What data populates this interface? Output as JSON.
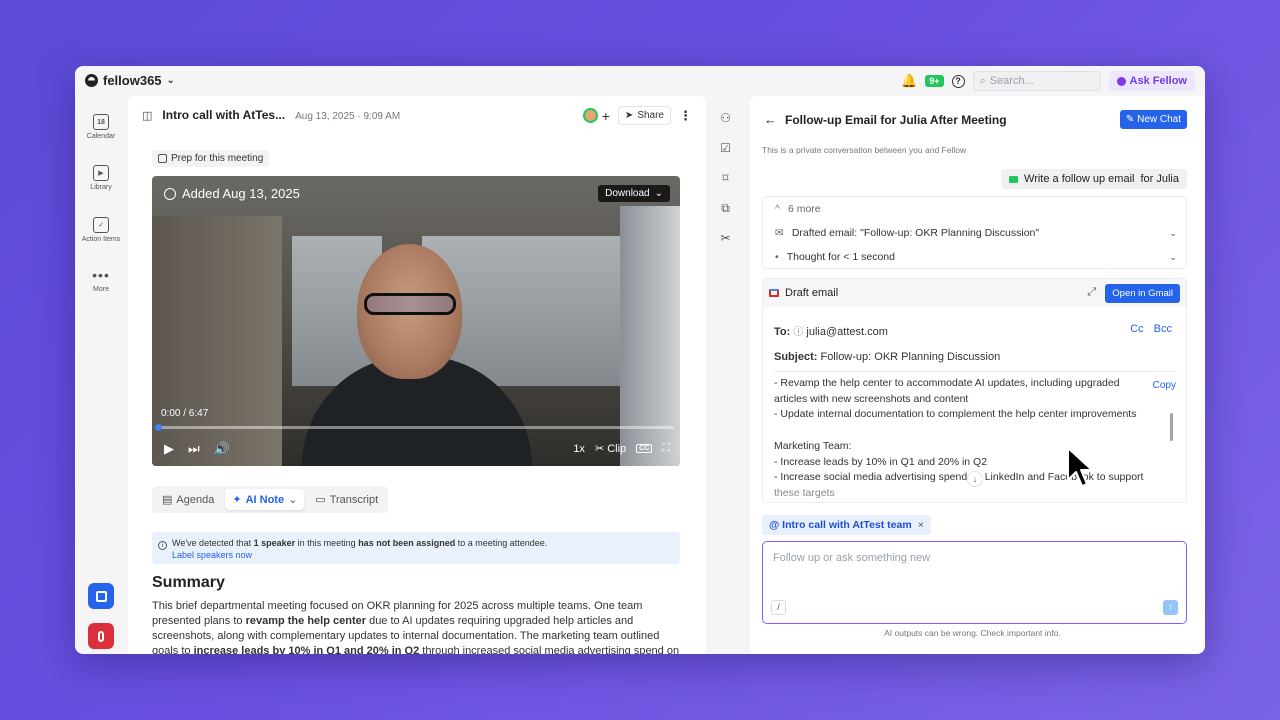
{
  "app": {
    "brand": "fellow365",
    "brand_caret": "⌄"
  },
  "topbar": {
    "notification_badge": "9+",
    "help_glyph": "?",
    "search_placeholder": "Search...",
    "ask_fellow_label": "Ask Fellow"
  },
  "rail": {
    "items": [
      {
        "label": "Calendar",
        "icon": "calendar-icon",
        "glyph": "18"
      },
      {
        "label": "Library",
        "icon": "library-icon",
        "glyph": "▶"
      },
      {
        "label": "Action Items",
        "icon": "checkbox-icon",
        "glyph": "✓"
      },
      {
        "label": "More",
        "icon": "more-icon",
        "glyph": "•••"
      }
    ],
    "bottom_buttons": [
      {
        "icon": "notes-icon",
        "color": "#2563eb"
      },
      {
        "icon": "microphone-icon",
        "color": "#dc2f3c"
      }
    ]
  },
  "meeting": {
    "title": "Intro call with AtTes...",
    "date": "Aug 13, 2025 · 9:09 AM",
    "share_label": "Share",
    "prep_label": "Prep for this meeting"
  },
  "video": {
    "added_label": "Added Aug 13, 2025",
    "download_label": "Download",
    "time": "0:00 / 6:47",
    "progress": 0,
    "speed": "1x",
    "clip_label": "Clip",
    "cc_label": "CC"
  },
  "tabs": [
    {
      "label": "Agenda",
      "active": false
    },
    {
      "label": "AI Note",
      "active": true
    },
    {
      "label": "Transcript",
      "active": false
    }
  ],
  "alert": {
    "text_1": "We've detected that ",
    "bold_1": "1 speaker",
    "text_2": " in this meeting ",
    "bold_2": "has not been assigned",
    "text_3": " to a meeting attendee.",
    "link": "Label speakers now"
  },
  "summary": {
    "title": "Summary",
    "p1": "This brief departmental meeting focused on OKR planning for 2025 across multiple teams. One team presented plans to ",
    "b1": "revamp the help center",
    "p2": " due to AI updates requiring upgraded help articles and screenshots, along with complementary updates to internal documentation. The marketing team outlined goals to ",
    "b2": "increase leads by 10% in Q1 and 20% in Q2",
    "p3": " through increased social media advertising spend on"
  },
  "chat": {
    "title": "Follow-up Email for Julia After Meeting",
    "new_chat_label": "New Chat",
    "private_note": "This is a private conversation between you and Fellow",
    "prompt_text": "Write a follow up email",
    "prompt_suffix": "for Julia",
    "steps": [
      {
        "label": "6 more",
        "prefix": "^"
      },
      {
        "label": "Drafted email: \"Follow-up: OKR Planning Discussion\"",
        "prefix": "✉"
      },
      {
        "label": "Thought for < 1 second",
        "prefix": "•"
      }
    ],
    "draft": {
      "header": "Draft email",
      "open_gmail_label": "Open in Gmail",
      "to_label": "To:",
      "to_value": "julia@attest.com",
      "cc_label": "Cc",
      "bcc_label": "Bcc",
      "subject_label": "Subject:",
      "subject_value": "Follow-up: OKR Planning Discussion",
      "copy_label": "Copy",
      "body_lines": [
        "- Revamp the help center to accommodate AI updates, including upgraded",
        "articles with new screenshots and content",
        "- Update internal documentation to complement the help center improvements",
        "",
        "Marketing Team:",
        "- Increase leads by 10% in Q1 and 20% in Q2",
        "- Increase social media advertising spend on LinkedIn and Facebook to support",
        "these targets"
      ]
    },
    "context_chip": "@ Intro call with AtTest team",
    "composer_placeholder": "Follow up or ask something new",
    "slash_label": "/",
    "disclaimer": "AI outputs can be wrong. Check important info."
  }
}
